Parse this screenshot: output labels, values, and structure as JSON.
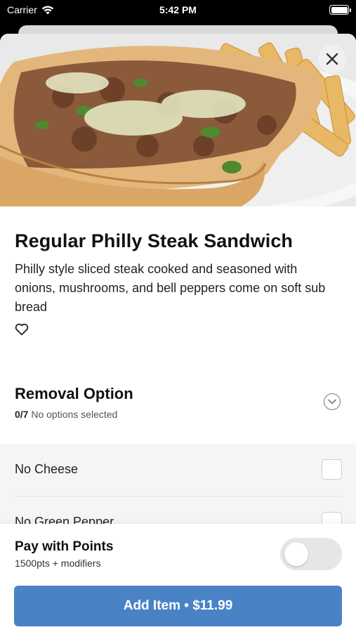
{
  "status_bar": {
    "carrier": "Carrier",
    "time": "5:42 PM"
  },
  "item": {
    "title": "Regular Philly Steak Sandwich",
    "description": "Philly style sliced steak cooked and seasoned with onions, mushrooms, and bell peppers come on soft sub bread"
  },
  "removal_section": {
    "title": "Removal Option",
    "count": "0/7",
    "status": "No options selected",
    "options": [
      {
        "label": "No Cheese"
      },
      {
        "label": "No Green Pepper"
      }
    ]
  },
  "points": {
    "title": "Pay with Points",
    "subtitle": "1500pts + modifiers",
    "enabled": false
  },
  "add_button": {
    "label": "Add Item • $11.99"
  },
  "colors": {
    "accent": "#4a82c6",
    "toggle_off": "#e6e6e6"
  },
  "icons": [
    "wifi-icon",
    "battery-icon",
    "close-icon",
    "heart-icon",
    "chevron-down-icon"
  ]
}
